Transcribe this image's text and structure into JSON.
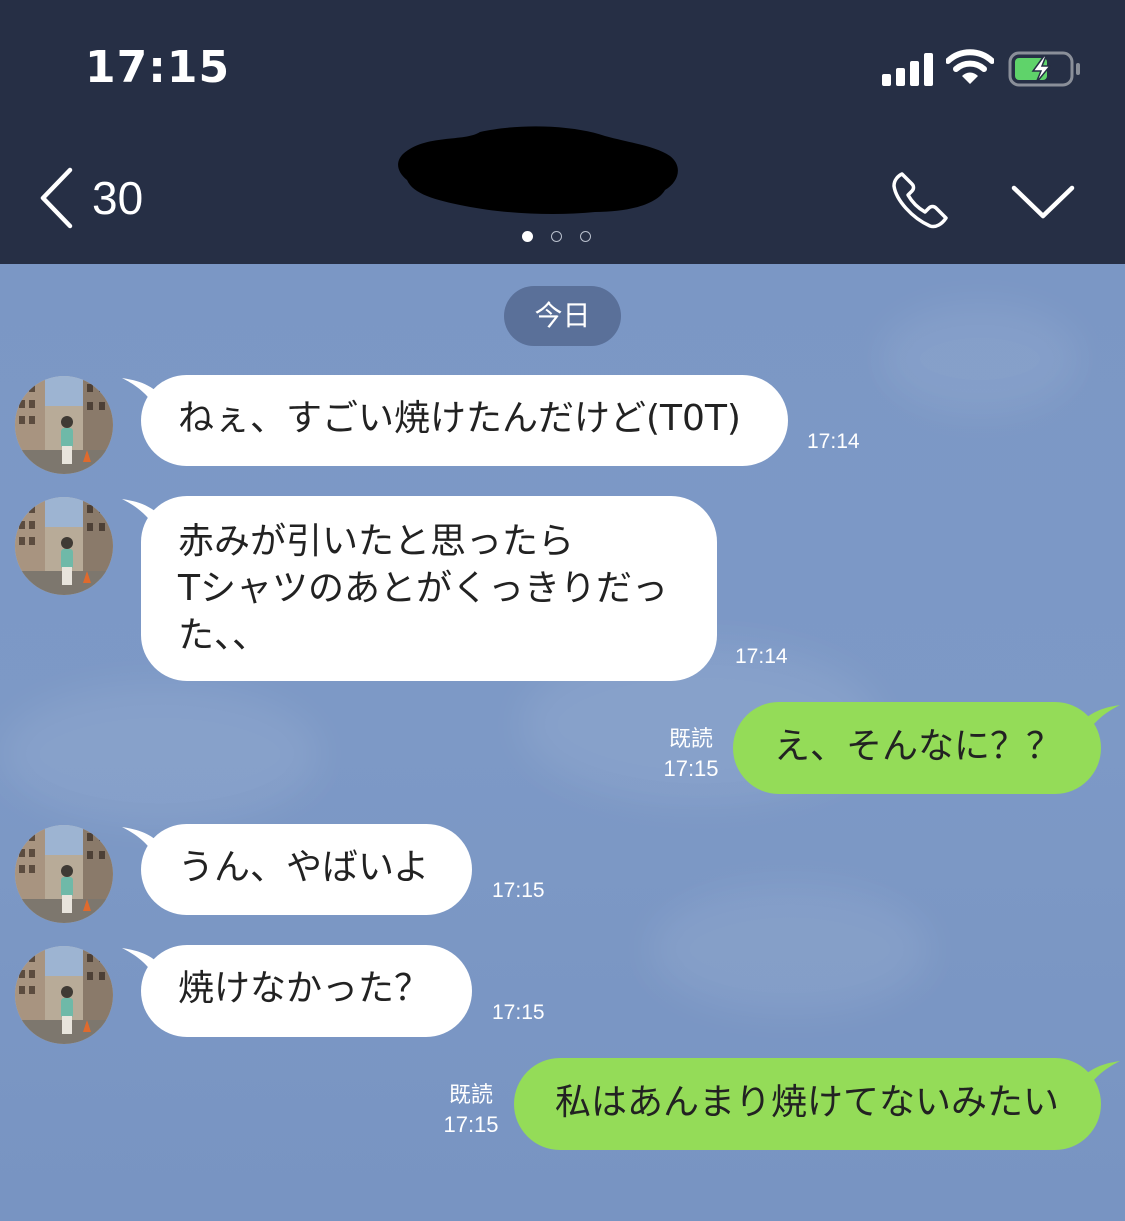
{
  "status_bar": {
    "time": "17:15"
  },
  "header": {
    "back_count": "30"
  },
  "date_divider": "今日",
  "messages": [
    {
      "direction": "in",
      "text": "ねぇ、すごい焼けたんだけど(T0T)",
      "time": "17:14"
    },
    {
      "direction": "in",
      "text": "赤みが引いたと思ったら\nTシャツのあとがくっきりだっ\nた、、",
      "time": "17:14"
    },
    {
      "direction": "out",
      "text": "え、そんなに？？",
      "time": "17:15",
      "read": "既読"
    },
    {
      "direction": "in",
      "text": "うん、やばいよ",
      "time": "17:15"
    },
    {
      "direction": "in",
      "text": "焼けなかった？",
      "time": "17:15"
    },
    {
      "direction": "out",
      "text": "私はあんまり焼けてないみたい",
      "time": "17:15",
      "read": "既読"
    }
  ],
  "colors": {
    "header_bg": "#262f45",
    "chat_bg": "#7b97c5",
    "incoming_bubble": "#ffffff",
    "outgoing_bubble": "#94dc58",
    "battery_fill": "#5fd36a"
  },
  "icons": [
    "back-chevron-icon",
    "phone-icon",
    "chevron-down-icon",
    "signal-icon",
    "wifi-icon",
    "battery-icon"
  ]
}
